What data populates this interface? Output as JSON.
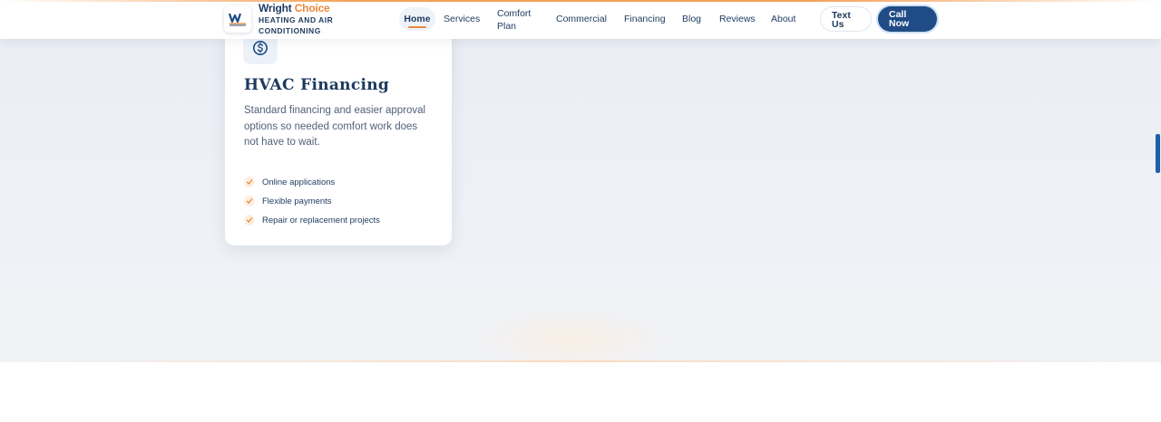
{
  "brand": {
    "name_part1": "Wright ",
    "name_part2": "Choice",
    "subtitle": "HEATING AND AIR CONDITIONING",
    "accent_color": "#e8883a",
    "primary_color": "#1f4c86"
  },
  "nav": {
    "home": "Home",
    "services": "Services",
    "comfort_plan_line1": "Comfort",
    "comfort_plan_line2": "Plan",
    "commercial": "Commercial",
    "financing": "Financing",
    "blog": "Blog",
    "reviews": "Reviews",
    "about": "About",
    "text_us_line1": "Text",
    "text_us_line2": "Us",
    "call_now_line1": "Call",
    "call_now_line2": "Now"
  },
  "card": {
    "icon": "dollar-circle-icon",
    "title": "HVAC Financing",
    "description": "Standard financing and easier approval options so needed comfort work does not have to wait.",
    "features": [
      "Online applications",
      "Flexible payments",
      "Repair or replacement projects"
    ]
  }
}
